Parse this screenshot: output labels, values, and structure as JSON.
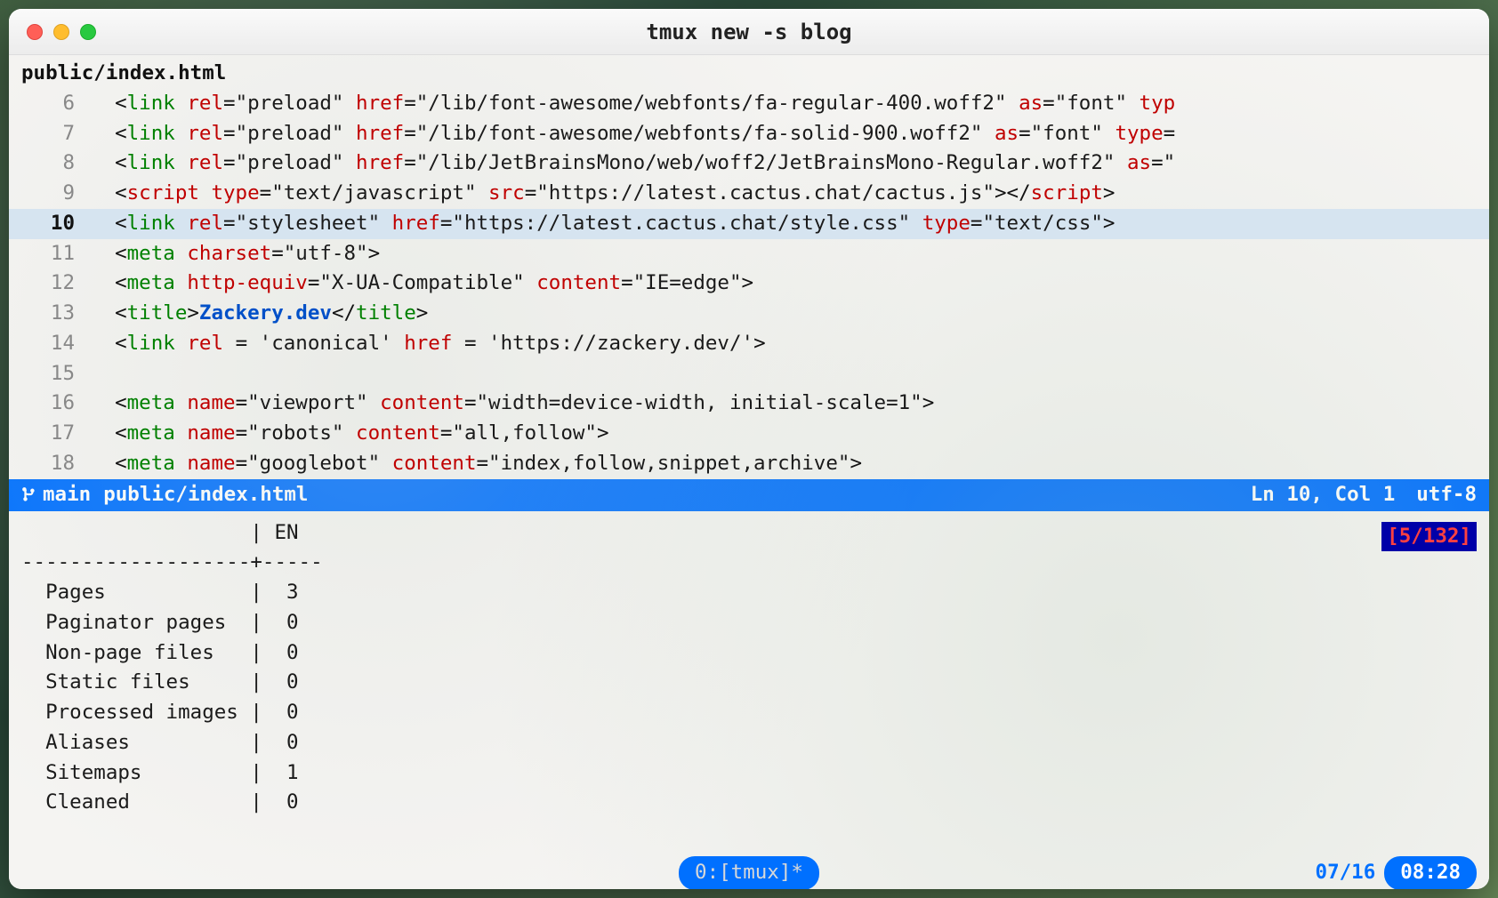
{
  "window": {
    "title": "tmux new -s blog"
  },
  "editor": {
    "file_path": "public/index.html",
    "current_line_index": 4,
    "lines": [
      {
        "n": 6,
        "tokens": [
          {
            "c": "t-angle",
            "t": "  <"
          },
          {
            "c": "t-tag",
            "t": "link"
          },
          {
            "c": "",
            "t": " "
          },
          {
            "c": "t-attr",
            "t": "rel"
          },
          {
            "c": "t-eq",
            "t": "="
          },
          {
            "c": "t-str",
            "t": "\"preload\""
          },
          {
            "c": "",
            "t": " "
          },
          {
            "c": "t-attr",
            "t": "href"
          },
          {
            "c": "t-eq",
            "t": "="
          },
          {
            "c": "t-str",
            "t": "\"/lib/font-awesome/webfonts/fa-regular-400.woff2\""
          },
          {
            "c": "",
            "t": " "
          },
          {
            "c": "t-attr",
            "t": "as"
          },
          {
            "c": "t-eq",
            "t": "="
          },
          {
            "c": "t-str",
            "t": "\"font\""
          },
          {
            "c": "",
            "t": " "
          },
          {
            "c": "t-attr",
            "t": "typ"
          }
        ]
      },
      {
        "n": 7,
        "tokens": [
          {
            "c": "t-angle",
            "t": "  <"
          },
          {
            "c": "t-tag",
            "t": "link"
          },
          {
            "c": "",
            "t": " "
          },
          {
            "c": "t-attr",
            "t": "rel"
          },
          {
            "c": "t-eq",
            "t": "="
          },
          {
            "c": "t-str",
            "t": "\"preload\""
          },
          {
            "c": "",
            "t": " "
          },
          {
            "c": "t-attr",
            "t": "href"
          },
          {
            "c": "t-eq",
            "t": "="
          },
          {
            "c": "t-str",
            "t": "\"/lib/font-awesome/webfonts/fa-solid-900.woff2\""
          },
          {
            "c": "",
            "t": " "
          },
          {
            "c": "t-attr",
            "t": "as"
          },
          {
            "c": "t-eq",
            "t": "="
          },
          {
            "c": "t-str",
            "t": "\"font\""
          },
          {
            "c": "",
            "t": " "
          },
          {
            "c": "t-attr",
            "t": "type"
          },
          {
            "c": "t-eq",
            "t": "="
          }
        ]
      },
      {
        "n": 8,
        "tokens": [
          {
            "c": "t-angle",
            "t": "  <"
          },
          {
            "c": "t-tag",
            "t": "link"
          },
          {
            "c": "",
            "t": " "
          },
          {
            "c": "t-attr",
            "t": "rel"
          },
          {
            "c": "t-eq",
            "t": "="
          },
          {
            "c": "t-str",
            "t": "\"preload\""
          },
          {
            "c": "",
            "t": " "
          },
          {
            "c": "t-attr",
            "t": "href"
          },
          {
            "c": "t-eq",
            "t": "="
          },
          {
            "c": "t-str",
            "t": "\"/lib/JetBrainsMono/web/woff2/JetBrainsMono-Regular.woff2\""
          },
          {
            "c": "",
            "t": " "
          },
          {
            "c": "t-attr",
            "t": "as"
          },
          {
            "c": "t-eq",
            "t": "="
          },
          {
            "c": "t-str",
            "t": "\""
          }
        ]
      },
      {
        "n": 9,
        "tokens": [
          {
            "c": "t-angle",
            "t": "  <"
          },
          {
            "c": "t-script",
            "t": "script"
          },
          {
            "c": "",
            "t": " "
          },
          {
            "c": "t-attr",
            "t": "type"
          },
          {
            "c": "t-eq",
            "t": "="
          },
          {
            "c": "t-str",
            "t": "\"text/javascript\""
          },
          {
            "c": "",
            "t": " "
          },
          {
            "c": "t-attr",
            "t": "src"
          },
          {
            "c": "t-eq",
            "t": "="
          },
          {
            "c": "t-str",
            "t": "\"https://latest.cactus.chat/cactus.js\""
          },
          {
            "c": "t-angle",
            "t": "></"
          },
          {
            "c": "t-script",
            "t": "script"
          },
          {
            "c": "t-angle",
            "t": ">"
          }
        ]
      },
      {
        "n": 10,
        "tokens": [
          {
            "c": "t-angle",
            "t": "  <"
          },
          {
            "c": "t-tag",
            "t": "link"
          },
          {
            "c": "",
            "t": " "
          },
          {
            "c": "t-attr",
            "t": "rel"
          },
          {
            "c": "t-eq",
            "t": "="
          },
          {
            "c": "t-str",
            "t": "\"stylesheet\""
          },
          {
            "c": "",
            "t": " "
          },
          {
            "c": "t-attr",
            "t": "href"
          },
          {
            "c": "t-eq",
            "t": "="
          },
          {
            "c": "t-str",
            "t": "\"https://latest.cactus.chat/style.css\""
          },
          {
            "c": "",
            "t": " "
          },
          {
            "c": "t-attr",
            "t": "type"
          },
          {
            "c": "t-eq",
            "t": "="
          },
          {
            "c": "t-str",
            "t": "\"text/css\""
          },
          {
            "c": "t-angle",
            "t": ">"
          }
        ]
      },
      {
        "n": 11,
        "tokens": [
          {
            "c": "t-angle",
            "t": "  <"
          },
          {
            "c": "t-tag",
            "t": "meta"
          },
          {
            "c": "",
            "t": " "
          },
          {
            "c": "t-attr",
            "t": "charset"
          },
          {
            "c": "t-eq",
            "t": "="
          },
          {
            "c": "t-str",
            "t": "\"utf-8\""
          },
          {
            "c": "t-angle",
            "t": ">"
          }
        ]
      },
      {
        "n": 12,
        "tokens": [
          {
            "c": "t-angle",
            "t": "  <"
          },
          {
            "c": "t-tag",
            "t": "meta"
          },
          {
            "c": "",
            "t": " "
          },
          {
            "c": "t-attr",
            "t": "http-equiv"
          },
          {
            "c": "t-eq",
            "t": "="
          },
          {
            "c": "t-str",
            "t": "\"X-UA-Compatible\""
          },
          {
            "c": "",
            "t": " "
          },
          {
            "c": "t-attr",
            "t": "content"
          },
          {
            "c": "t-eq",
            "t": "="
          },
          {
            "c": "t-str",
            "t": "\"IE=edge\""
          },
          {
            "c": "t-angle",
            "t": ">"
          }
        ]
      },
      {
        "n": 13,
        "tokens": [
          {
            "c": "t-angle",
            "t": "  <"
          },
          {
            "c": "t-tag",
            "t": "title"
          },
          {
            "c": "t-angle",
            "t": ">"
          },
          {
            "c": "t-title",
            "t": "Zackery.dev"
          },
          {
            "c": "t-angle",
            "t": "</"
          },
          {
            "c": "t-tag",
            "t": "title"
          },
          {
            "c": "t-angle",
            "t": ">"
          }
        ]
      },
      {
        "n": 14,
        "tokens": [
          {
            "c": "t-angle",
            "t": "  <"
          },
          {
            "c": "t-tag",
            "t": "link"
          },
          {
            "c": "",
            "t": " "
          },
          {
            "c": "t-attr",
            "t": "rel"
          },
          {
            "c": "",
            "t": " "
          },
          {
            "c": "t-eq",
            "t": "="
          },
          {
            "c": "",
            "t": " "
          },
          {
            "c": "t-str",
            "t": "'canonical'"
          },
          {
            "c": "",
            "t": " "
          },
          {
            "c": "t-attr",
            "t": "href"
          },
          {
            "c": "",
            "t": " "
          },
          {
            "c": "t-eq",
            "t": "="
          },
          {
            "c": "",
            "t": " "
          },
          {
            "c": "t-str",
            "t": "'https://zackery.dev/'"
          },
          {
            "c": "t-angle",
            "t": ">"
          }
        ]
      },
      {
        "n": 15,
        "tokens": [
          {
            "c": "",
            "t": ""
          }
        ]
      },
      {
        "n": 16,
        "tokens": [
          {
            "c": "t-angle",
            "t": "  <"
          },
          {
            "c": "t-tag",
            "t": "meta"
          },
          {
            "c": "",
            "t": " "
          },
          {
            "c": "t-attr",
            "t": "name"
          },
          {
            "c": "t-eq",
            "t": "="
          },
          {
            "c": "t-str",
            "t": "\"viewport\""
          },
          {
            "c": "",
            "t": " "
          },
          {
            "c": "t-attr",
            "t": "content"
          },
          {
            "c": "t-eq",
            "t": "="
          },
          {
            "c": "t-str",
            "t": "\"width=device-width, initial-scale=1\""
          },
          {
            "c": "t-angle",
            "t": ">"
          }
        ]
      },
      {
        "n": 17,
        "tokens": [
          {
            "c": "t-angle",
            "t": "  <"
          },
          {
            "c": "t-tag",
            "t": "meta"
          },
          {
            "c": "",
            "t": " "
          },
          {
            "c": "t-attr",
            "t": "name"
          },
          {
            "c": "t-eq",
            "t": "="
          },
          {
            "c": "t-str",
            "t": "\"robots\""
          },
          {
            "c": "",
            "t": " "
          },
          {
            "c": "t-attr",
            "t": "content"
          },
          {
            "c": "t-eq",
            "t": "="
          },
          {
            "c": "t-str",
            "t": "\"all,follow\""
          },
          {
            "c": "t-angle",
            "t": ">"
          }
        ]
      },
      {
        "n": 18,
        "tokens": [
          {
            "c": "t-angle",
            "t": "  <"
          },
          {
            "c": "t-tag",
            "t": "meta"
          },
          {
            "c": "",
            "t": " "
          },
          {
            "c": "t-attr",
            "t": "name"
          },
          {
            "c": "t-eq",
            "t": "="
          },
          {
            "c": "t-str",
            "t": "\"googlebot\""
          },
          {
            "c": "",
            "t": " "
          },
          {
            "c": "t-attr",
            "t": "content"
          },
          {
            "c": "t-eq",
            "t": "="
          },
          {
            "c": "t-str",
            "t": "\"index,follow,snippet,archive\""
          },
          {
            "c": "t-angle",
            "t": ">"
          }
        ]
      }
    ]
  },
  "status": {
    "branch": "main",
    "file": "public/index.html",
    "position": "Ln 10, Col 1",
    "encoding": "utf-8"
  },
  "hlcount": "[5/132]",
  "build_table": {
    "header": "                   | EN  ",
    "divider": "-------------------+-----",
    "rows": [
      "  Pages            |  3  ",
      "  Paginator pages  |  0  ",
      "  Non-page files   |  0  ",
      "  Static files     |  0  ",
      "  Processed images |  0  ",
      "  Aliases          |  0  ",
      "  Sitemaps         |  1  ",
      "  Cleaned          |  0  "
    ]
  },
  "tmux": {
    "window_label": "0:[tmux]*",
    "date": "07/16",
    "time": "08:28"
  }
}
